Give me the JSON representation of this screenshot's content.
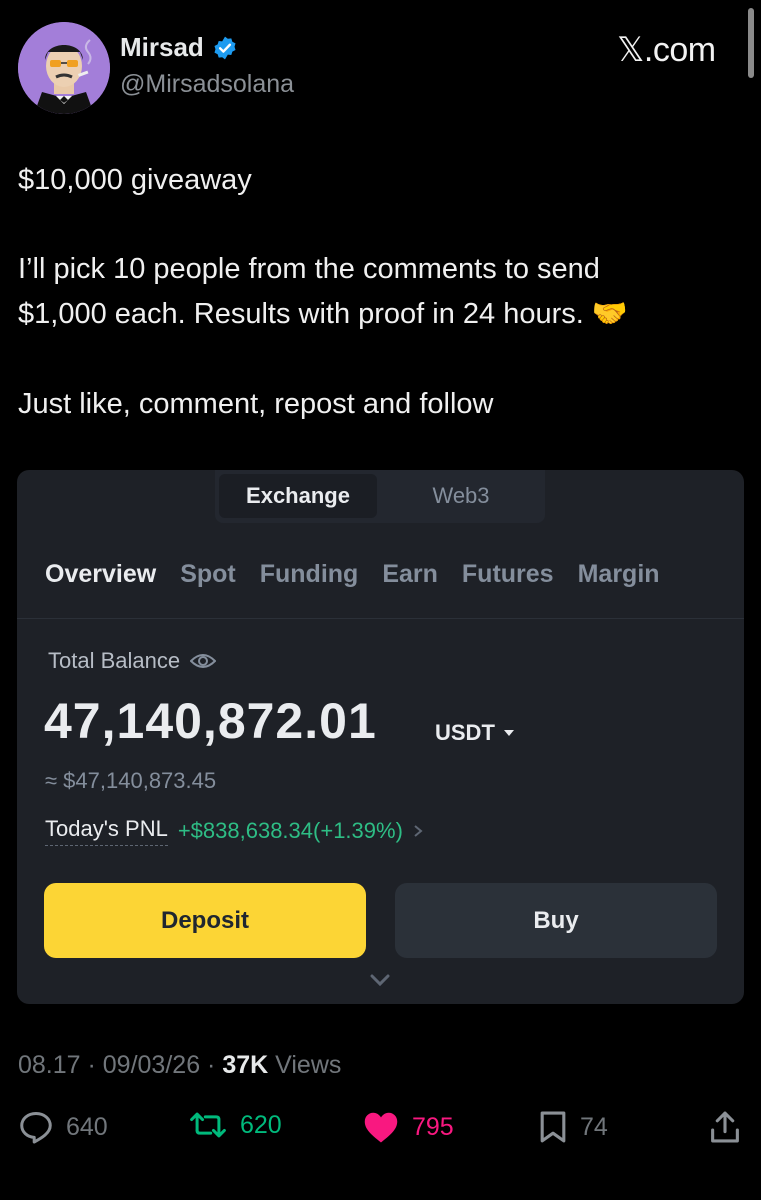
{
  "author": {
    "name": "Mirsad",
    "handle": "@Mirsadsolana",
    "verified": true
  },
  "brand": {
    "x_glyph": "𝕏",
    "suffix": ".com"
  },
  "post": {
    "line1": "$10,000 giveaway",
    "line2": "I’ll pick 10 people from the comments to send",
    "line3": "$1,000 each. Results with proof in 24 hours. 🤝",
    "line4": "Just like, comment, repost and follow"
  },
  "embedded": {
    "switch_tabs": [
      "Exchange",
      "Web3"
    ],
    "tabs": [
      "Overview",
      "Spot",
      "Funding",
      "Earn",
      "Futures",
      "Margin"
    ],
    "total_balance_label": "Total Balance",
    "total_balance": "47,140,872.01",
    "unit": "USDT",
    "approx_usd": "≈ $47,140,873.45",
    "pnl_label": "Today's PNL",
    "pnl_value": "+$838,638.34(+1.39%)",
    "deposit_label": "Deposit",
    "buy_label": "Buy"
  },
  "meta": {
    "time": "08.17 · 09/03/26 · ",
    "views_count": "37K",
    "views_label": " Views"
  },
  "stats": {
    "replies": "640",
    "reposts": "620",
    "likes": "795",
    "bookmarks": "74"
  },
  "colors": {
    "like": "#f91880",
    "repost": "#00ba7c",
    "verified": "#1d9bf0",
    "deposit": "#fcd535",
    "pnl": "#2ebd85"
  }
}
